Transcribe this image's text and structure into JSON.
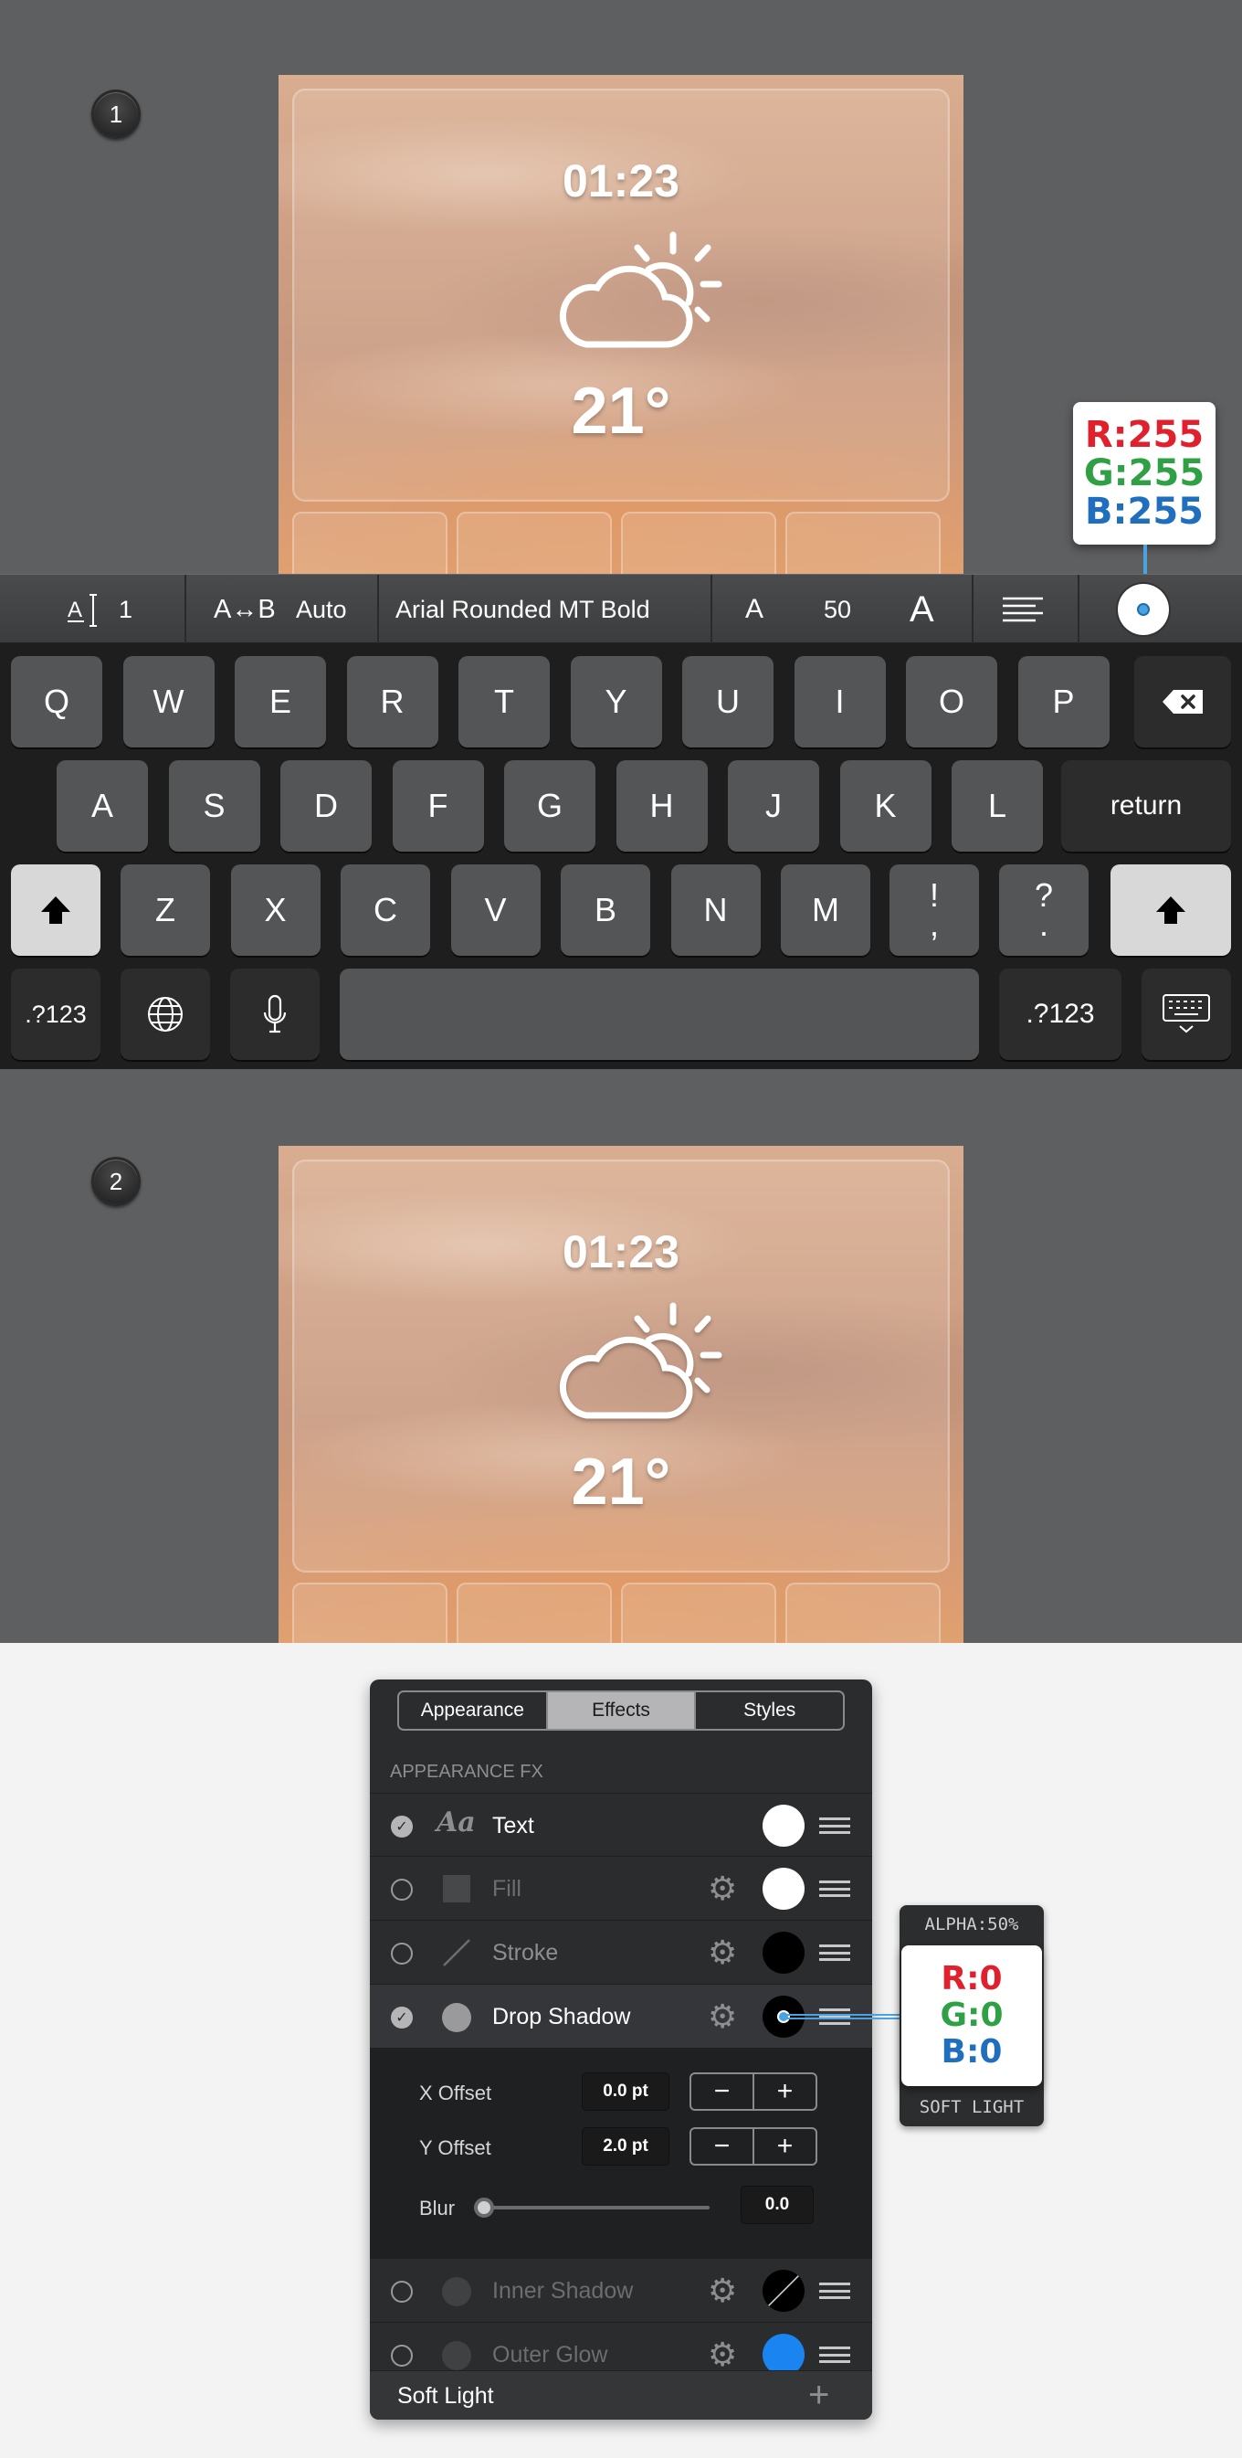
{
  "steps": {
    "one": "1",
    "two": "2"
  },
  "widget": {
    "time": "01:23",
    "temperature": "21°",
    "weather_icon": "partly-cloudy-icon"
  },
  "toolbar": {
    "line_spacing_icon": "line-spacing-icon",
    "line_spacing_value": "1",
    "kerning_icon": "A↔B",
    "kerning_value": "Auto",
    "font_name": "Arial Rounded MT Bold",
    "size_decrease": "A",
    "font_size": "50",
    "size_increase": "A",
    "align_icon": "align-left-icon",
    "color_swatch": "#ffffff"
  },
  "color_tooltip_top": {
    "r": "R:255",
    "g": "G:255",
    "b": "B:255"
  },
  "keyboard": {
    "row1": [
      "Q",
      "W",
      "E",
      "R",
      "T",
      "Y",
      "U",
      "I",
      "O",
      "P"
    ],
    "row2": [
      "A",
      "S",
      "D",
      "F",
      "G",
      "H",
      "J",
      "K",
      "L"
    ],
    "row3": [
      "Z",
      "X",
      "C",
      "V",
      "B",
      "N",
      "M"
    ],
    "return_label": "return",
    "excl_top": "!",
    "excl_bottom": ",",
    "quest_top": "?",
    "quest_bottom": ".",
    "numbers_label": ".?123"
  },
  "panel": {
    "tabs": [
      "Appearance",
      "Effects",
      "Styles"
    ],
    "active_tab": "Effects",
    "section_header": "APPEARANCE FX",
    "rows": [
      {
        "label": "Text",
        "icon": "Aa",
        "checked": true,
        "swatch": "#ffffff"
      },
      {
        "label": "Fill",
        "checked": false,
        "swatch": "#ffffff"
      },
      {
        "label": "Stroke",
        "checked": false,
        "swatch": "#000000"
      },
      {
        "label": "Drop Shadow",
        "checked": true,
        "swatch": "#000000"
      },
      {
        "label": "Inner Shadow",
        "checked": false,
        "swatch": "#000000"
      },
      {
        "label": "Outer Glow",
        "checked": false,
        "swatch": "#1a84f0"
      }
    ],
    "x_offset_label": "X Offset",
    "x_offset_value": "0.0 pt",
    "y_offset_label": "Y Offset",
    "y_offset_value": "2.0 pt",
    "blur_label": "Blur",
    "blur_value": "0.0",
    "blend_mode": "Soft Light",
    "stepper_minus": "−",
    "stepper_plus": "+"
  },
  "color_tooltip_bottom": {
    "alpha": "ALPHA:50%",
    "r": "R:0",
    "g": "G:0",
    "b": "B:0",
    "mode": "SOFT LIGHT"
  }
}
